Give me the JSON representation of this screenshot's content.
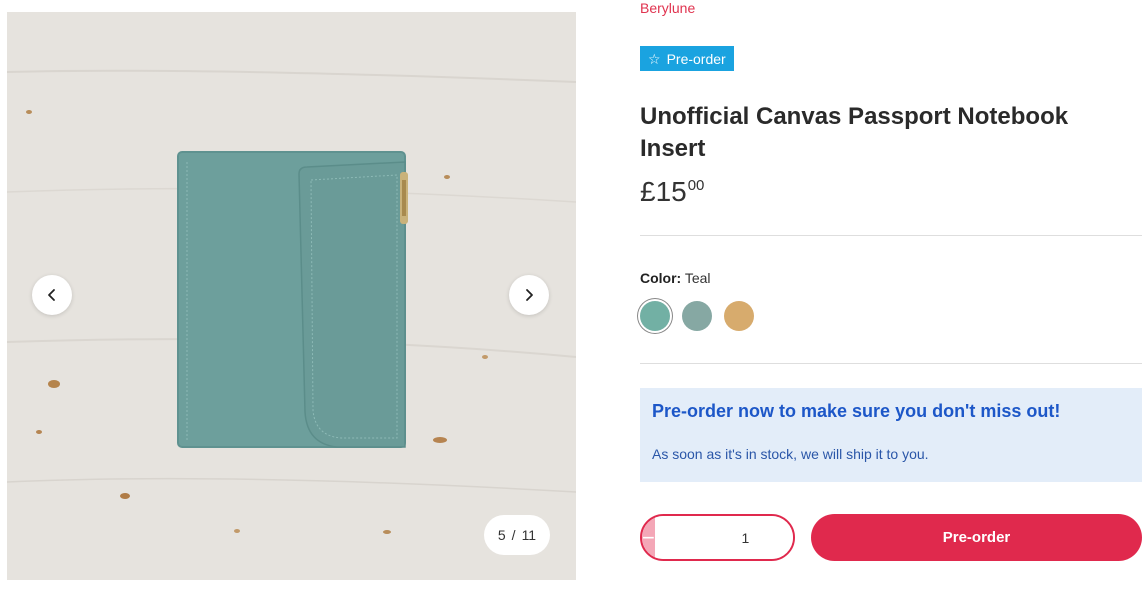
{
  "gallery": {
    "counter_current": "5",
    "counter_sep": "/",
    "counter_total": "11",
    "prev_icon": "chevron-left-icon",
    "next_icon": "chevron-right-icon"
  },
  "product": {
    "brand": "Berylune",
    "badge_icon": "star-outline-icon",
    "badge_label": "Pre-order",
    "title": "Unofficial Canvas Passport Notebook Insert",
    "price_main": "£15",
    "price_cents": "00"
  },
  "variant": {
    "label": "Color:",
    "selected": "Teal",
    "swatches": [
      {
        "name": "Teal",
        "color": "#72b0a4"
      },
      {
        "name": "Slate Green",
        "color": "#86a8a3"
      },
      {
        "name": "Tan",
        "color": "#d7ab6d"
      }
    ]
  },
  "notice": {
    "title": "Pre-order now to make sure you don't miss out!",
    "text": "As soon as it's in stock, we will ship it to you."
  },
  "cart": {
    "quantity": "1",
    "minus_label": "−",
    "plus_label": "+",
    "button_label": "Pre-order"
  },
  "colors": {
    "accent": "#e0294d",
    "brand": "#e0334f",
    "badge": "#1aa3e0",
    "notice_bg": "#e3edf9",
    "notice_text": "#1d57c8"
  }
}
